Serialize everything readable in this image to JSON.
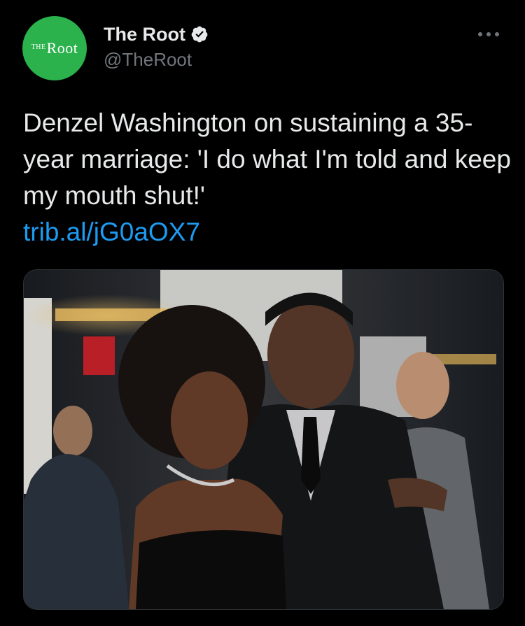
{
  "account": {
    "avatar_text_small": "THE",
    "avatar_text_large": "Root",
    "display_name": "The Root",
    "handle": "@TheRoot"
  },
  "tweet": {
    "text": "Denzel Washington on sustaining a 35-year marriage: 'I do what I'm told and keep my mouth shut!'",
    "link": "trib.al/jG0aOX7"
  },
  "icons": {
    "verified": "verified-badge-icon",
    "more": "more-options-icon"
  },
  "colors": {
    "background": "#000000",
    "text": "#e7e9ea",
    "secondary": "#71767b",
    "link": "#1d9bf0",
    "avatar_bg": "#2bb24c"
  }
}
